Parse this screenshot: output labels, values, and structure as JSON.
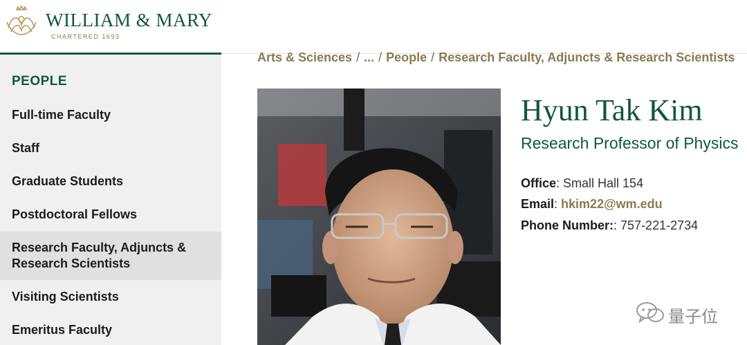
{
  "header": {
    "logo_name": "WILLIAM & MARY",
    "logo_sub": "CHARTERED 1693"
  },
  "sidebar": {
    "heading": "PEOPLE",
    "items": [
      {
        "label": "Full-time Faculty"
      },
      {
        "label": "Staff"
      },
      {
        "label": "Graduate Students"
      },
      {
        "label": "Postdoctoral Fellows"
      },
      {
        "label": "Research Faculty, Adjuncts & Research Scientists",
        "active": true
      },
      {
        "label": "Visiting Scientists"
      },
      {
        "label": "Emeritus Faculty"
      }
    ]
  },
  "breadcrumb": {
    "items": [
      "Arts & Sciences",
      "...",
      "People",
      "Research Faculty, Adjuncts & Research Scientists"
    ],
    "separator": "/"
  },
  "profile": {
    "name": "Hyun Tak Kim",
    "title": "Research Professor of Physics",
    "office_label": "Office",
    "office_value": "Small Hall 154",
    "email_label": "Email",
    "email_value": "hkim22@wm.edu",
    "phone_label": "Phone Number:",
    "phone_value": "757-221-2734"
  },
  "watermark": {
    "text": "量子位"
  },
  "colors": {
    "brand_green": "#115740",
    "gold": "#8b7a52",
    "sidebar_bg": "#f0f0f0",
    "sidebar_active_bg": "#e0e0e0"
  }
}
